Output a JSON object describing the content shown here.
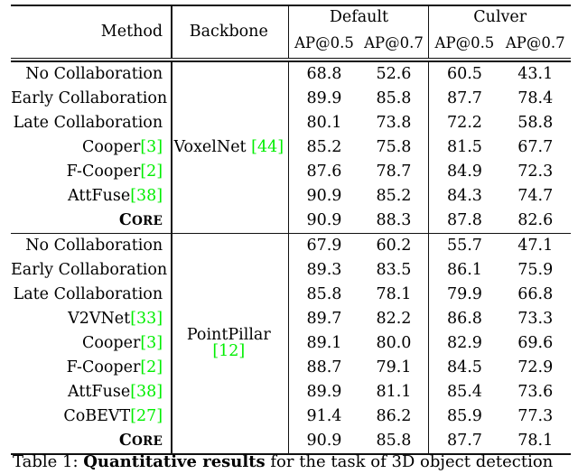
{
  "table": {
    "headers": {
      "method": "Method",
      "backbone": "Backbone",
      "groups": [
        {
          "label": "Default",
          "sub": "AP@0.5 AP@0.7",
          "sub_left": "AP@0.5",
          "sub_right": "AP@0.7"
        },
        {
          "label": "Culver",
          "sub": "AP@0.5 AP@0.7",
          "sub_left": "AP@0.5",
          "sub_right": "AP@0.7"
        }
      ]
    },
    "blocks": [
      {
        "backbone_name": "VoxelNet",
        "backbone_cite": "[44]",
        "rows": [
          {
            "method": "No Collaboration",
            "cite": "",
            "default_ap50": "68.8",
            "default_ap70": "52.6",
            "culver_ap50": "60.5",
            "culver_ap70": "43.1",
            "bold": [
              false,
              false,
              false,
              false
            ],
            "smallcaps": false
          },
          {
            "method": "Early Collaboration",
            "cite": "",
            "default_ap50": "89.9",
            "default_ap70": "85.8",
            "culver_ap50": "87.7",
            "culver_ap70": "78.4",
            "bold": [
              false,
              false,
              false,
              false
            ],
            "smallcaps": false
          },
          {
            "method": "Late Collaboration",
            "cite": "",
            "default_ap50": "80.1",
            "default_ap70": "73.8",
            "culver_ap50": "72.2",
            "culver_ap70": "58.8",
            "bold": [
              false,
              false,
              false,
              false
            ],
            "smallcaps": false
          },
          {
            "method": "Cooper",
            "cite": "[3]",
            "default_ap50": "85.2",
            "default_ap70": "75.8",
            "culver_ap50": "81.5",
            "culver_ap70": "67.7",
            "bold": [
              false,
              false,
              false,
              false
            ],
            "smallcaps": false
          },
          {
            "method": "F-Cooper",
            "cite": "[2]",
            "default_ap50": "87.6",
            "default_ap70": "78.7",
            "culver_ap50": "84.9",
            "culver_ap70": "72.3",
            "bold": [
              false,
              false,
              false,
              false
            ],
            "smallcaps": false
          },
          {
            "method": "AttFuse",
            "cite": "[38]",
            "default_ap50": "90.9",
            "default_ap70": "85.2",
            "culver_ap50": "84.3",
            "culver_ap70": "74.7",
            "bold": [
              true,
              false,
              false,
              false
            ],
            "smallcaps": false
          },
          {
            "method": "CORE",
            "cite": "",
            "default_ap50": "90.9",
            "default_ap70": "88.3",
            "culver_ap50": "87.8",
            "culver_ap70": "82.6",
            "bold": [
              true,
              true,
              true,
              true
            ],
            "smallcaps": true
          }
        ]
      },
      {
        "backbone_name": "PointPillar",
        "backbone_cite": "[12]",
        "rows": [
          {
            "method": "No Collaboration",
            "cite": "",
            "default_ap50": "67.9",
            "default_ap70": "60.2",
            "culver_ap50": "55.7",
            "culver_ap70": "47.1",
            "bold": [
              false,
              false,
              false,
              false
            ],
            "smallcaps": false
          },
          {
            "method": "Early Collaboration",
            "cite": "",
            "default_ap50": "89.3",
            "default_ap70": "83.5",
            "culver_ap50": "86.1",
            "culver_ap70": "75.9",
            "bold": [
              false,
              false,
              false,
              false
            ],
            "smallcaps": false
          },
          {
            "method": "Late Collaboration",
            "cite": "",
            "default_ap50": "85.8",
            "default_ap70": "78.1",
            "culver_ap50": "79.9",
            "culver_ap70": "66.8",
            "bold": [
              false,
              false,
              false,
              false
            ],
            "smallcaps": false
          },
          {
            "method": "V2VNet",
            "cite": "[33]",
            "default_ap50": "89.7",
            "default_ap70": "82.2",
            "culver_ap50": "86.8",
            "culver_ap70": "73.3",
            "bold": [
              false,
              false,
              false,
              false
            ],
            "smallcaps": false
          },
          {
            "method": "Cooper",
            "cite": "[3]",
            "default_ap50": "89.1",
            "default_ap70": "80.0",
            "culver_ap50": "82.9",
            "culver_ap70": "69.6",
            "bold": [
              false,
              false,
              false,
              false
            ],
            "smallcaps": false
          },
          {
            "method": "F-Cooper",
            "cite": "[2]",
            "default_ap50": "88.7",
            "default_ap70": "79.1",
            "culver_ap50": "84.5",
            "culver_ap70": "72.9",
            "bold": [
              false,
              false,
              false,
              false
            ],
            "smallcaps": false
          },
          {
            "method": "AttFuse",
            "cite": "[38]",
            "default_ap50": "89.9",
            "default_ap70": "81.1",
            "culver_ap50": "85.4",
            "culver_ap70": "73.6",
            "bold": [
              false,
              false,
              false,
              false
            ],
            "smallcaps": false
          },
          {
            "method": "CoBEVT",
            "cite": "[27]",
            "default_ap50": "91.4",
            "default_ap70": "86.2",
            "culver_ap50": "85.9",
            "culver_ap70": "77.3",
            "bold": [
              true,
              true,
              false,
              false
            ],
            "smallcaps": false
          },
          {
            "method": "CORE",
            "cite": "",
            "default_ap50": "90.9",
            "default_ap70": "85.8",
            "culver_ap50": "87.7",
            "culver_ap70": "78.1",
            "bold": [
              false,
              false,
              true,
              true
            ],
            "smallcaps": true
          }
        ]
      }
    ]
  },
  "caption": {
    "prefix": "Table 1: ",
    "bold_part": "Quantitative results",
    "rest": " for the task of 3D object detection"
  },
  "colors": {
    "citation_green": "#00ee00",
    "header_background": "#eceaea",
    "rule": "#111111",
    "text": "#000000"
  }
}
